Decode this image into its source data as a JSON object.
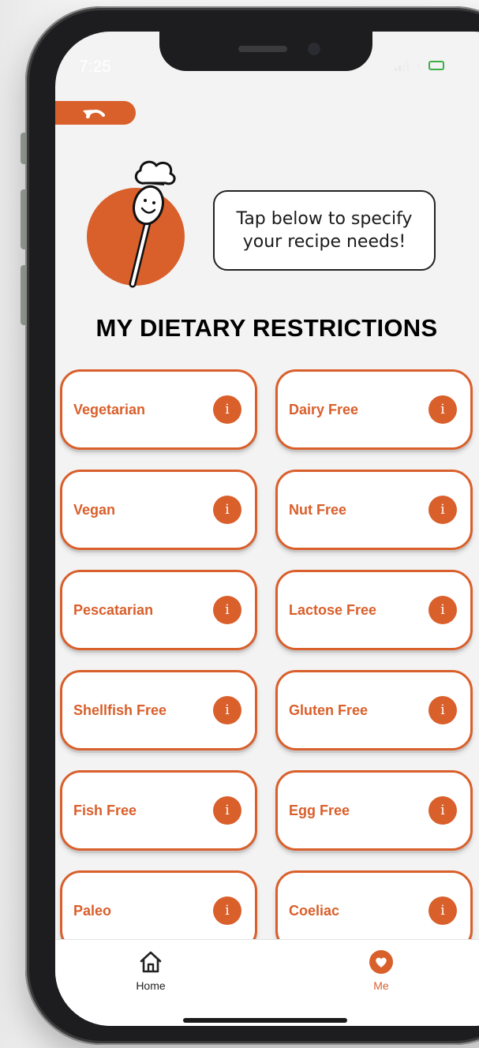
{
  "status_bar": {
    "time": "7:25"
  },
  "header": {
    "back_icon": "undo-arrow-icon",
    "mascot_icon": "chef-spoon-mascot-icon",
    "bubble_line1": "Tap below to specify",
    "bubble_line2": "your recipe needs!"
  },
  "section_title": "MY DIETARY RESTRICTIONS",
  "restrictions": [
    {
      "label": "Vegetarian"
    },
    {
      "label": "Dairy Free"
    },
    {
      "label": "Vegan"
    },
    {
      "label": "Nut Free"
    },
    {
      "label": "Pescatarian"
    },
    {
      "label": "Lactose Free"
    },
    {
      "label": "Shellfish Free"
    },
    {
      "label": "Gluten Free"
    },
    {
      "label": "Fish Free"
    },
    {
      "label": "Egg Free"
    },
    {
      "label": "Paleo"
    },
    {
      "label": "Coeliac"
    }
  ],
  "info_glyph": "i",
  "tab_bar": {
    "home_label": "Home",
    "me_label": "Me",
    "selected": "Me"
  },
  "colors": {
    "accent": "#d95f2b",
    "inactive_tab": "#222222",
    "background": "#f3f3f3"
  }
}
